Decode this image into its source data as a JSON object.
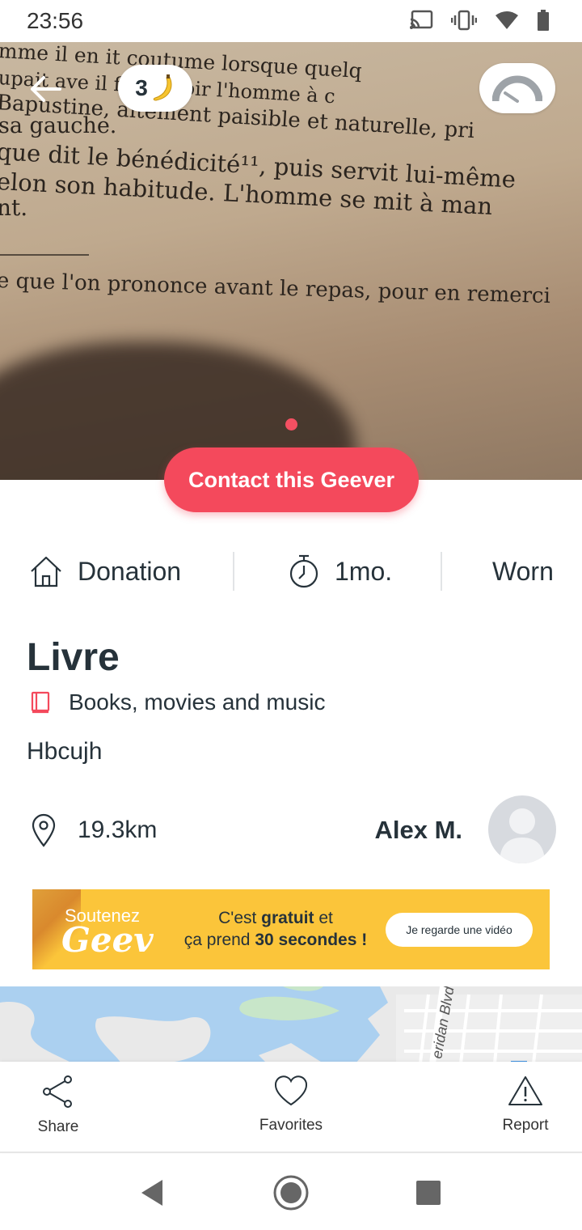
{
  "status_bar": {
    "time": "23:56"
  },
  "hero": {
    "page_lines": [
      "mme il en   it coutume lorsque quelq",
      "upait ave   il fit asseoir l'homme à c",
      "Bapustine,  aitement paisible et naturelle, pri",
      "sa gauche.",
      "que dit le bénédicité¹¹, puis servit lui-même",
      "elon son habitude. L'homme se mit à man",
      "nt.",
      "e que l'on prononce avant le repas, pour en remerci"
    ],
    "bananas_count": "3"
  },
  "contact_button_label": "Contact this Geever",
  "info": {
    "type_label": "Donation",
    "age_label": "1mo.",
    "condition_label": "Worn"
  },
  "item": {
    "title": "Livre",
    "category": "Books, movies and music",
    "description": "Hbcujh",
    "distance": "19.3km",
    "owner": "Alex M."
  },
  "ad": {
    "brand_top": "Soutenez",
    "brand_logo": "Geev",
    "text_line1_pre": "C'est ",
    "text_line1_bold": "gratuit",
    "text_line1_post": " et",
    "text_line2_pre": "ça prend ",
    "text_line2_bold": "30 secondes !",
    "button_label": "Je regarde une vidéo"
  },
  "map": {
    "street_label": "eridan Blvd"
  },
  "actions": {
    "share_label": "Share",
    "favorites_label": "Favorites",
    "report_label": "Report"
  },
  "colors": {
    "accent": "#f4495c",
    "ad_background": "#fbc53a",
    "text": "#26323a"
  }
}
